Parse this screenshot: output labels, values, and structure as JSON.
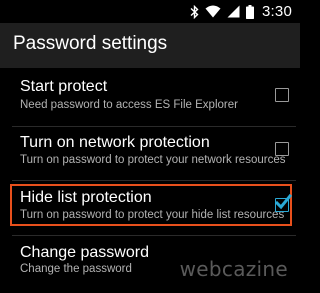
{
  "status_bar": {
    "time": "3:30",
    "icons": [
      "bluetooth-icon",
      "wifi-icon",
      "signal-icon",
      "battery-icon"
    ]
  },
  "action_bar": {
    "title": "Password settings"
  },
  "settings": [
    {
      "title": "Start protect",
      "summary": "Need password to access ES File Explorer",
      "checked": false
    },
    {
      "title": "Turn on network protection",
      "summary": "Turn on password to protect your network resources",
      "checked": false
    },
    {
      "title": "Hide list protection",
      "summary": "Turn on password to protect your hide list resources",
      "checked": true,
      "highlighted": true
    },
    {
      "title": "Change password",
      "summary": "Change the password"
    }
  ],
  "watermark": "webcazine",
  "colors": {
    "background": "#000000",
    "action_bar": "#1f1f1f",
    "accent": "#2aa9d6",
    "highlight_border": "#e8501c"
  }
}
